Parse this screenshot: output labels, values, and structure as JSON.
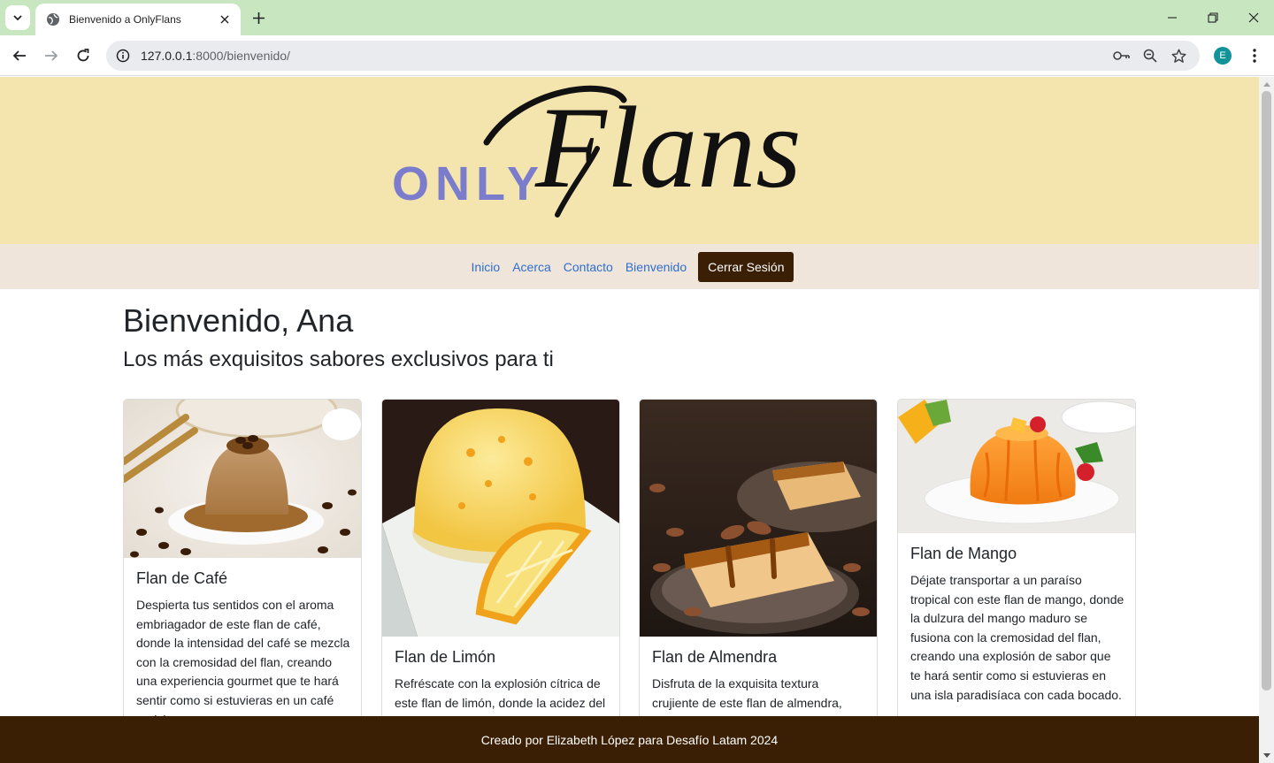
{
  "browser": {
    "tab_title": "Bienvenido a OnlyFlans",
    "url_host": "127.0.0.1",
    "url_path": ":8000/bienvenido/",
    "profile_initial": "E",
    "tabbar_color": "#c8e6c0"
  },
  "site": {
    "logo_only": "ONLY",
    "logo_flans": "Flans",
    "nav": [
      {
        "label": "Inicio"
      },
      {
        "label": "Acerca"
      },
      {
        "label": "Contacto"
      },
      {
        "label": "Bienvenido"
      }
    ],
    "logout_label": "Cerrar Sesión",
    "colors": {
      "hero": "#f4e4ae",
      "nav_bar": "#efe5da",
      "brown": "#3b1f05",
      "link": "#2f6fd1",
      "logo_only": "#7b7dcc"
    }
  },
  "main": {
    "greeting": "Bienvenido, Ana",
    "subtitle": "Los más exquisitos sabores exclusivos para ti",
    "cards": [
      {
        "title": "Flan de Café",
        "text": "Despierta tus sentidos con el aroma embriagador de este flan de café, donde la intensidad del café se mezcla con la cremosidad del flan, creando una experiencia gourmet que te hará sentir como si estuvieras en un café parisino."
      },
      {
        "title": "Flan de Limón",
        "text": "Refréscate con la explosión cítrica de este flan de limón, donde la acidez del limón se equilibra con la suavidad del flan."
      },
      {
        "title": "Flan de Almendra",
        "text": "Disfruta de la exquisita textura crujiente de este flan de almendra, donde cada bocado es una delicia."
      },
      {
        "title": "Flan de Mango",
        "text": "Déjate transportar a un paraíso tropical con este flan de mango, donde la dulzura del mango maduro se fusiona con la cremosidad del flan, creando una explosión de sabor que te hará sentir como si estuvieras en una isla paradisíaca con cada bocado."
      }
    ]
  },
  "footer": {
    "text": "Creado por Elizabeth López para Desafío Latam 2024"
  }
}
